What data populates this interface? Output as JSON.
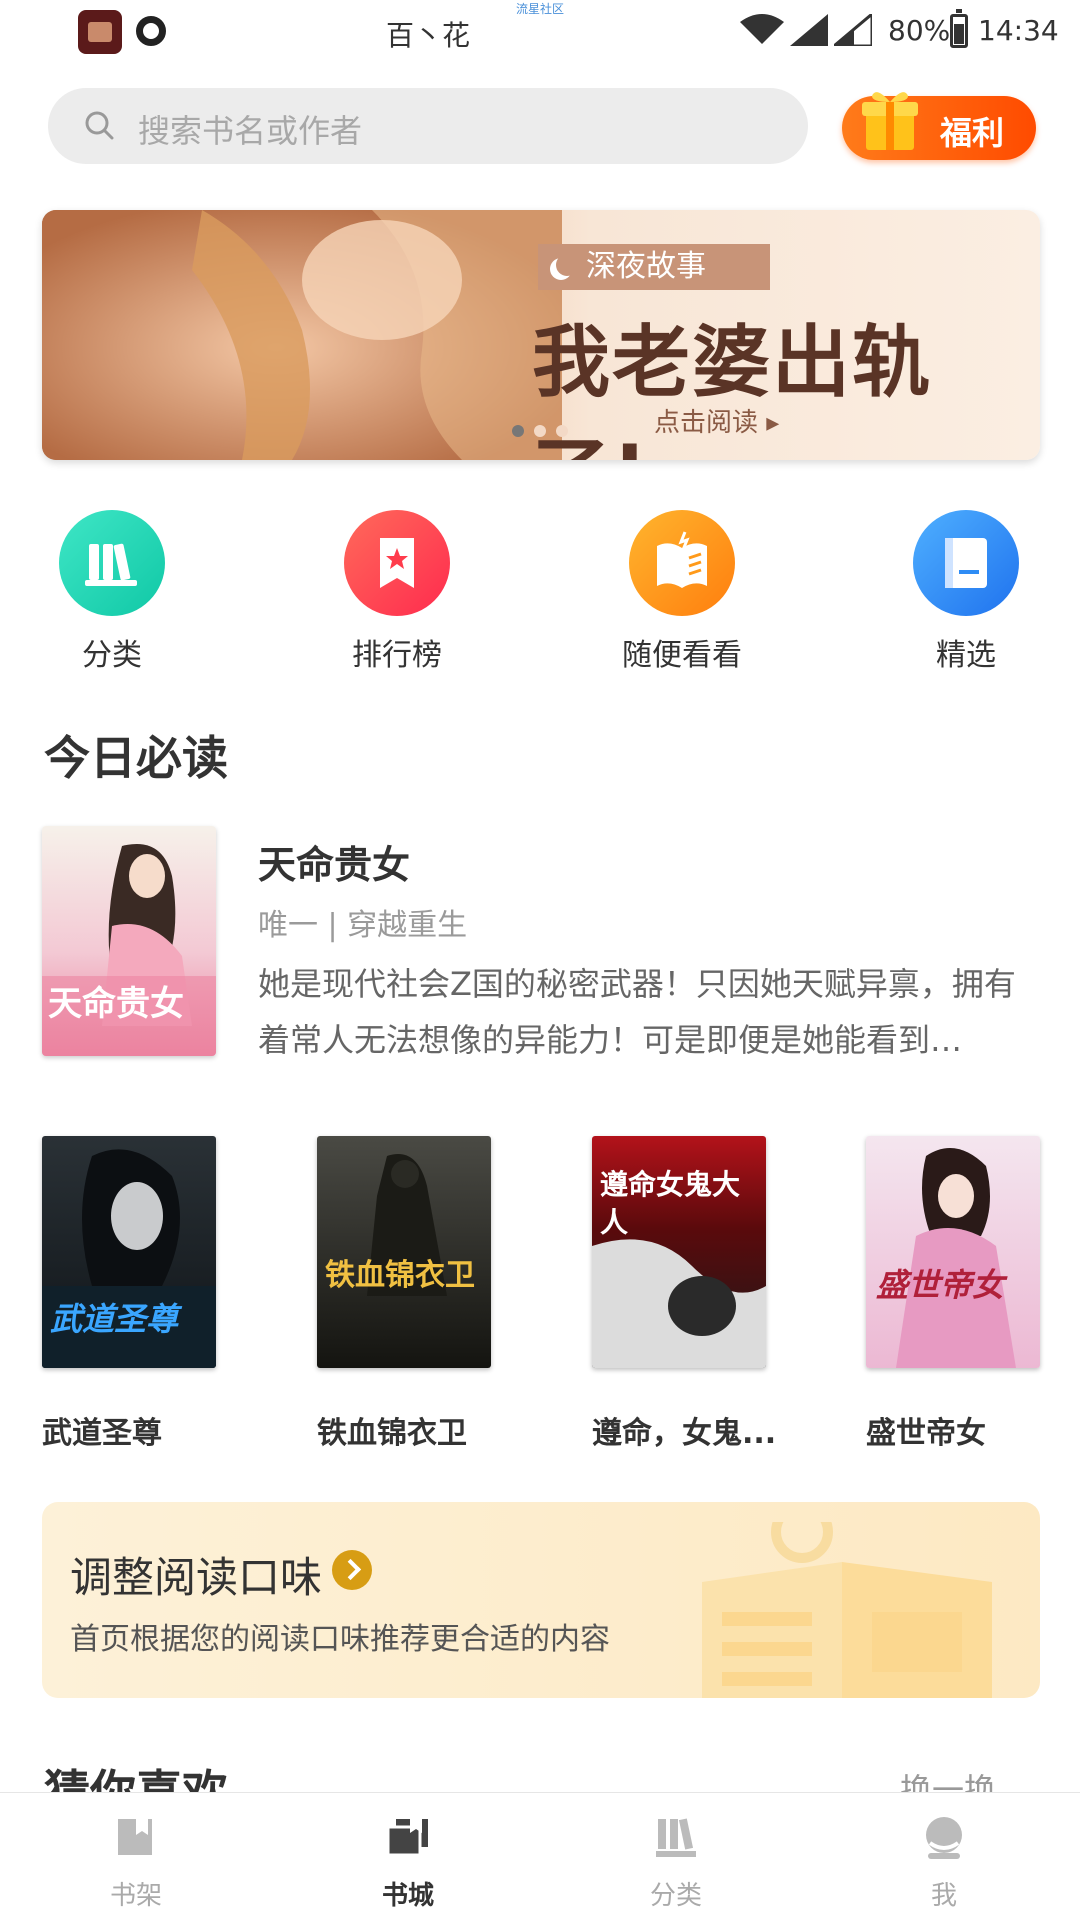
{
  "status_bar": {
    "carrier": "百丶花",
    "watermark": "流星社区",
    "battery": "80%",
    "time": "14:34"
  },
  "search": {
    "placeholder": "搜索书名或作者"
  },
  "welfare_button": {
    "label": "福利"
  },
  "banner": {
    "tag": "深夜故事",
    "title": "我老婆出轨了!",
    "cta": "点击阅读 ▸",
    "pages": 3,
    "active_page": 1
  },
  "quick_nav": [
    {
      "label": "分类",
      "icon": "category-icon",
      "color": "#1fd3b3"
    },
    {
      "label": "排行榜",
      "icon": "ranking-icon",
      "color": "#ff3c4c"
    },
    {
      "label": "随便看看",
      "icon": "browse-icon",
      "color": "#ff9a1a"
    },
    {
      "label": "精选",
      "icon": "selected-icon",
      "color": "#2e8cf5"
    }
  ],
  "today": {
    "section_title": "今日必读",
    "featured": {
      "cover_text": "天命贵女",
      "title": "天命贵女",
      "meta": "唯一 | 穿越重生",
      "description": "她是现代社会Z国的秘密武器！只因她天赋异禀，拥有着常人无法想像的异能力！可是即便是她能看到…"
    },
    "books": [
      {
        "title": "武道圣尊",
        "cover_text": "武道圣尊"
      },
      {
        "title": "铁血锦衣卫",
        "cover_text": "铁血锦衣卫"
      },
      {
        "title": "遵命，女鬼...",
        "cover_text": "遵命女鬼大人"
      },
      {
        "title": "盛世帝女",
        "cover_text": "盛世帝女"
      }
    ]
  },
  "taste_card": {
    "title": "调整阅读口味",
    "subtitle": "首页根据您的阅读口味推荐更合适的内容"
  },
  "guess": {
    "section_title": "猜你喜欢",
    "refresh": "换一换"
  },
  "tabbar": [
    {
      "label": "书架",
      "icon": "bookshelf-icon",
      "active": false
    },
    {
      "label": "书城",
      "icon": "bookstore-icon",
      "active": true
    },
    {
      "label": "分类",
      "icon": "category-tab-icon",
      "active": false
    },
    {
      "label": "我",
      "icon": "profile-icon",
      "active": false
    }
  ],
  "colors": {
    "accent": "#ff5a00",
    "tab_active": "#333333",
    "tab_inactive": "#aaaaaa"
  }
}
